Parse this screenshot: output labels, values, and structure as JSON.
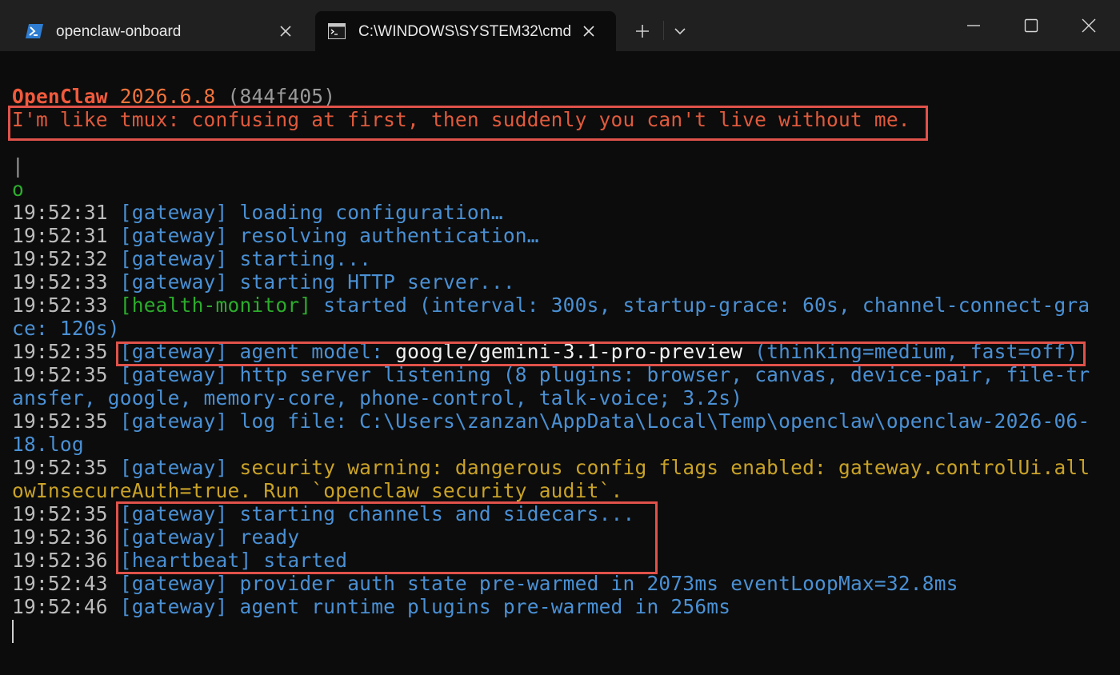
{
  "window": {
    "tabs": [
      {
        "title": "openclaw-onboard",
        "icon": "powershell-icon",
        "active": false
      },
      {
        "title": "C:\\WINDOWS\\SYSTEM32\\cmd",
        "icon": "cmd-icon",
        "active": true
      }
    ],
    "new_tab_label": "+",
    "controls": [
      "minimize-icon",
      "maximize-icon",
      "close-icon"
    ]
  },
  "terminal": {
    "banner": {
      "name": "OpenClaw",
      "version": "2026.6.8",
      "build": "(844f405)",
      "tagline": "I'm like tmux: confusing at first, then suddenly you can't live without me."
    },
    "pipe": "|",
    "marker": "o",
    "log": [
      {
        "time": "19:52:31",
        "tag": "[gateway]",
        "msg": "loading configuration…"
      },
      {
        "time": "19:52:31",
        "tag": "[gateway]",
        "msg": "resolving authentication…"
      },
      {
        "time": "19:52:32",
        "tag": "[gateway]",
        "msg": "starting..."
      },
      {
        "time": "19:52:33",
        "tag": "[gateway]",
        "msg": "starting HTTP server..."
      },
      {
        "time": "19:52:33",
        "tag": "[health-monitor]",
        "msg": "started (interval: 300s, startup-grace: 60s, channel-connect-gra",
        "cont": "ce: 120s)"
      },
      {
        "time": "19:52:35",
        "tag": "[gateway]",
        "msg": "agent model:",
        "model": "google/gemini-3.1-pro-preview",
        "extra": "(thinking=medium, fast=off)"
      },
      {
        "time": "19:52:35",
        "tag": "[gateway]",
        "msg": "http server listening (8 plugins: browser, canvas, device-pair, file-tr",
        "cont": "ansfer, google, memory-core, phone-control, talk-voice; 3.2s)"
      },
      {
        "time": "19:52:35",
        "tag": "[gateway]",
        "msg": "log file: C:\\Users\\zanzan\\AppData\\Local\\Temp\\openclaw\\openclaw-2026-06-",
        "cont": "18.log"
      },
      {
        "time": "19:52:35",
        "tag": "[gateway]",
        "msg": "security warning: dangerous config flags enabled: gateway.controlUi.all",
        "cont": "owInsecureAuth=true. Run `openclaw security audit`."
      },
      {
        "time": "19:52:35",
        "tag": "[gateway]",
        "msg": "starting channels and sidecars..."
      },
      {
        "time": "19:52:36",
        "tag": "[gateway]",
        "msg": "ready"
      },
      {
        "time": "19:52:36",
        "tag": "[heartbeat]",
        "msg": "started"
      },
      {
        "time": "19:52:43",
        "tag": "[gateway]",
        "msg": "provider auth state pre-warmed in 2073ms eventLoopMax=32.8ms"
      },
      {
        "time": "19:52:46",
        "tag": "[gateway]",
        "msg": "agent runtime plugins pre-warmed in 256ms"
      }
    ]
  },
  "colors": {
    "background": "#0c0c0c",
    "timestamp": "#bcbcbc",
    "gateway": "#4a90d4",
    "health_monitor": "#2cac2c",
    "warning": "#c9a227",
    "highlight_box": "#e0524a",
    "banner": "#f05a3c"
  }
}
